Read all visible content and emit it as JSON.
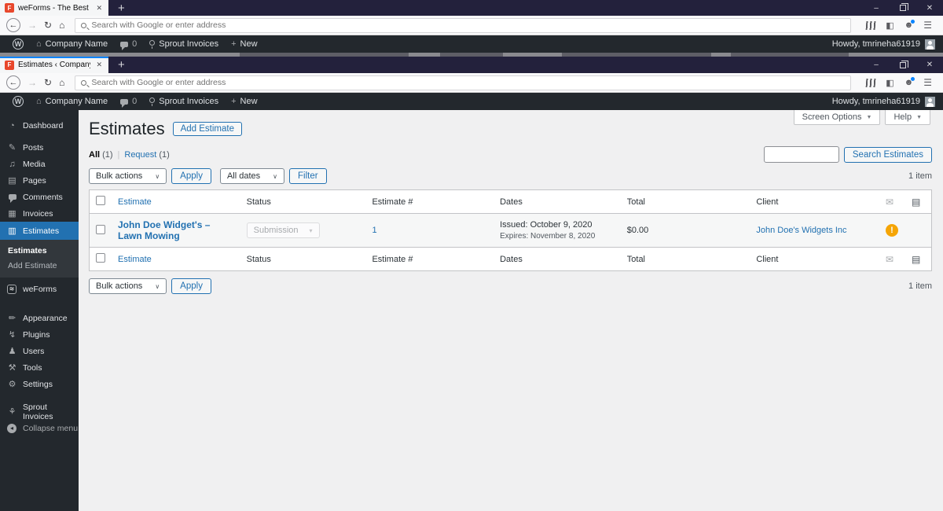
{
  "chrome": {
    "win1_tab_title": "weForms - The Best Contact Fo",
    "win2_tab_title": "Estimates ‹ Company Name —",
    "url_placeholder": "Search with Google or enter address",
    "favicon_letter": "F",
    "close_tab": "✕",
    "new_tab": "+",
    "minimize": "–",
    "close_window": "✕",
    "back": "←",
    "forward": "→",
    "reload": "↻",
    "home": "⌂",
    "account": "☻",
    "sidebar_toggle": "◧",
    "hamburger": "☰"
  },
  "admin_bar": {
    "wp": "W",
    "house": "⌂",
    "site_name": "Company Name",
    "comments_count": "0",
    "sprout_label": "Sprout Invoices",
    "plus": "+",
    "new_label": "New",
    "howdy": "Howdy, tmrineha61919"
  },
  "icons": {
    "dashboard": "◔",
    "posts": "✎",
    "media": "♫",
    "pages": "▤",
    "invoices": "▦",
    "estimates": "▥",
    "weforms": "≋",
    "appearance": "✏",
    "plugins": "↯",
    "users": "♟",
    "tools": "⚒",
    "settings": "⚙",
    "sprout": "⚘",
    "collapse": "◂",
    "envelope": "✉",
    "doc": "▤",
    "alert": "!",
    "chevron": "∨",
    "caret_down": "▼",
    "select_chev": "▾"
  },
  "sidebar": {
    "items": [
      {
        "label": "Dashboard"
      },
      {
        "label": "Posts"
      },
      {
        "label": "Media"
      },
      {
        "label": "Pages"
      },
      {
        "label": "Comments"
      },
      {
        "label": "Invoices"
      },
      {
        "label": "Estimates"
      },
      {
        "label": "weForms"
      },
      {
        "label": "Appearance"
      },
      {
        "label": "Plugins"
      },
      {
        "label": "Users"
      },
      {
        "label": "Tools"
      },
      {
        "label": "Settings"
      },
      {
        "label": "Sprout Invoices"
      },
      {
        "label": "Collapse menu"
      }
    ],
    "submenu": [
      {
        "label": "Estimates"
      },
      {
        "label": "Add Estimate"
      }
    ]
  },
  "page": {
    "title": "Estimates",
    "add_estimate": "Add Estimate",
    "screen_options": "Screen Options",
    "help": "Help",
    "views": {
      "all": "All",
      "all_count": "(1)",
      "sep": "|",
      "request": "Request",
      "request_count": "(1)"
    },
    "bulk_actions": "Bulk actions",
    "apply": "Apply",
    "all_dates": "All dates",
    "filter": "Filter",
    "search_estimates": "Search Estimates",
    "item_count": "1 item",
    "table": {
      "col_estimate": "Estimate",
      "col_status": "Status",
      "col_number": "Estimate #",
      "col_dates": "Dates",
      "col_total": "Total",
      "col_client": "Client",
      "row": {
        "title": "John Doe Widget's – Lawn Mowing",
        "status": "Submission",
        "number": "1",
        "issued": "Issued: October 9, 2020",
        "expires": "Expires: November 8, 2020",
        "total": "$0.00",
        "client": "John Doe's Widgets Inc"
      }
    }
  },
  "colors": {
    "accent_blue": "#2271b1",
    "titlebar": "#23213c",
    "adminbar": "#23282d",
    "alert_orange": "#f5a506",
    "tab_accent": "#0a84ff",
    "content_bg": "#f0f0f1"
  }
}
